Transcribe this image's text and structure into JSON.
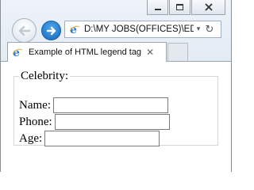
{
  "browser": {
    "address": "D:\\MY JOBS(OFFICES)\\ED",
    "tab_title": "Example of HTML legend tag",
    "tab_close": "✕",
    "icons": {
      "back": "back-arrow-icon",
      "forward": "forward-arrow-icon",
      "page": "ie-page-icon",
      "refresh": "refresh-icon",
      "dropdown": "dropdown-icon",
      "minimize": "minimize-icon",
      "maximize": "maximize-icon",
      "close": "close-icon"
    },
    "colors": {
      "forward_button": "#1667b8",
      "ie_icon": "#1a7ad6"
    }
  },
  "form": {
    "legend": "Celebrity:",
    "fields": [
      {
        "label": "Name:",
        "value": ""
      },
      {
        "label": "Phone:",
        "value": ""
      },
      {
        "label": "Age:",
        "value": ""
      }
    ]
  }
}
